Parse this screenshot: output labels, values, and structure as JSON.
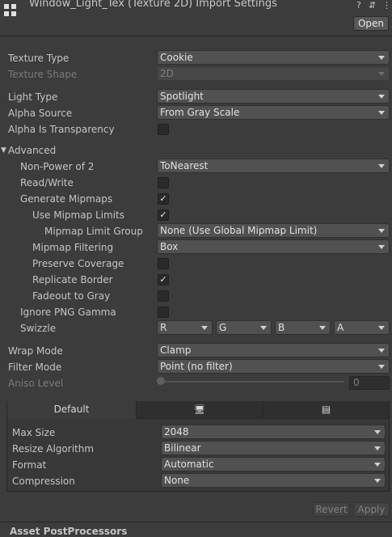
{
  "header": {
    "title": "Window_Light_Tex (Texture 2D) Import Settings",
    "open_label": "Open",
    "help_glyph": "?",
    "settings_glyph": "⇵",
    "more_glyph": "⋮"
  },
  "rows": {
    "texture_type": {
      "label": "Texture Type",
      "value": "Cookie"
    },
    "texture_shape": {
      "label": "Texture Shape",
      "value": "2D"
    },
    "light_type": {
      "label": "Light Type",
      "value": "Spotlight"
    },
    "alpha_source": {
      "label": "Alpha Source",
      "value": "From Gray Scale"
    },
    "alpha_is_transparency": {
      "label": "Alpha Is Transparency",
      "checked": ""
    },
    "advanced": {
      "label": "Advanced"
    },
    "non_power_of_2": {
      "label": "Non-Power of 2",
      "value": "ToNearest"
    },
    "read_write": {
      "label": "Read/Write",
      "checked": ""
    },
    "generate_mipmaps": {
      "label": "Generate Mipmaps",
      "checked": "✓"
    },
    "use_mipmap_limits": {
      "label": "Use Mipmap Limits",
      "checked": "✓"
    },
    "mipmap_limit_group": {
      "label": "Mipmap Limit Group",
      "value": "None (Use Global Mipmap Limit)"
    },
    "mipmap_filtering": {
      "label": "Mipmap Filtering",
      "value": "Box"
    },
    "preserve_coverage": {
      "label": "Preserve Coverage",
      "checked": ""
    },
    "replicate_border": {
      "label": "Replicate Border",
      "checked": "✓"
    },
    "fadeout_to_gray": {
      "label": "Fadeout to Gray",
      "checked": ""
    },
    "ignore_png_gamma": {
      "label": "Ignore PNG Gamma",
      "checked": ""
    },
    "swizzle": {
      "label": "Swizzle",
      "r": "R",
      "g": "G",
      "b": "B",
      "a": "A"
    },
    "wrap_mode": {
      "label": "Wrap Mode",
      "value": "Clamp"
    },
    "filter_mode": {
      "label": "Filter Mode",
      "value": "Point (no filter)"
    },
    "aniso_level": {
      "label": "Aniso Level",
      "value": "0"
    }
  },
  "platform": {
    "tab_default": "Default",
    "monitor_glyph": "🖥",
    "server_glyph": "▤",
    "max_size": {
      "label": "Max Size",
      "value": "2048"
    },
    "resize_algorithm": {
      "label": "Resize Algorithm",
      "value": "Bilinear"
    },
    "format": {
      "label": "Format",
      "value": "Automatic"
    },
    "compression": {
      "label": "Compression",
      "value": "None"
    }
  },
  "footer": {
    "revert_label": "Revert",
    "apply_label": "Apply",
    "cut_label": "Asset PostProcessors"
  }
}
